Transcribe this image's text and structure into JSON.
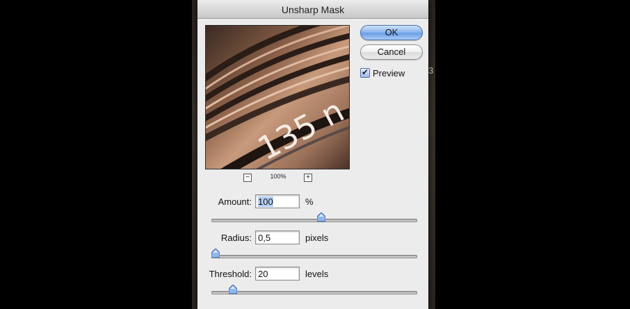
{
  "dialog": {
    "title": "Unsharp Mask",
    "zoom_level": "100%",
    "zoom_out_symbol": "−",
    "zoom_in_symbol": "+",
    "buttons": {
      "ok": "OK",
      "cancel": "Cancel"
    },
    "preview": {
      "label": "Preview",
      "checked": true,
      "check_mark": "✔"
    },
    "preview_image_text": "135 n",
    "fields": {
      "amount": {
        "label": "Amount:",
        "value": "100",
        "unit": "%",
        "slider_fraction": 0.54
      },
      "radius": {
        "label": "Radius:",
        "value": "0,5",
        "unit": "pixels",
        "slider_fraction": 0.0
      },
      "threshold": {
        "label": "Threshold:",
        "value": "20",
        "unit": "levels",
        "slider_fraction": 0.09
      }
    },
    "colors": {
      "accent": "#6b9fe6",
      "dialog_bg": "#ececec"
    }
  },
  "background": {
    "partial_glyph": "3"
  }
}
